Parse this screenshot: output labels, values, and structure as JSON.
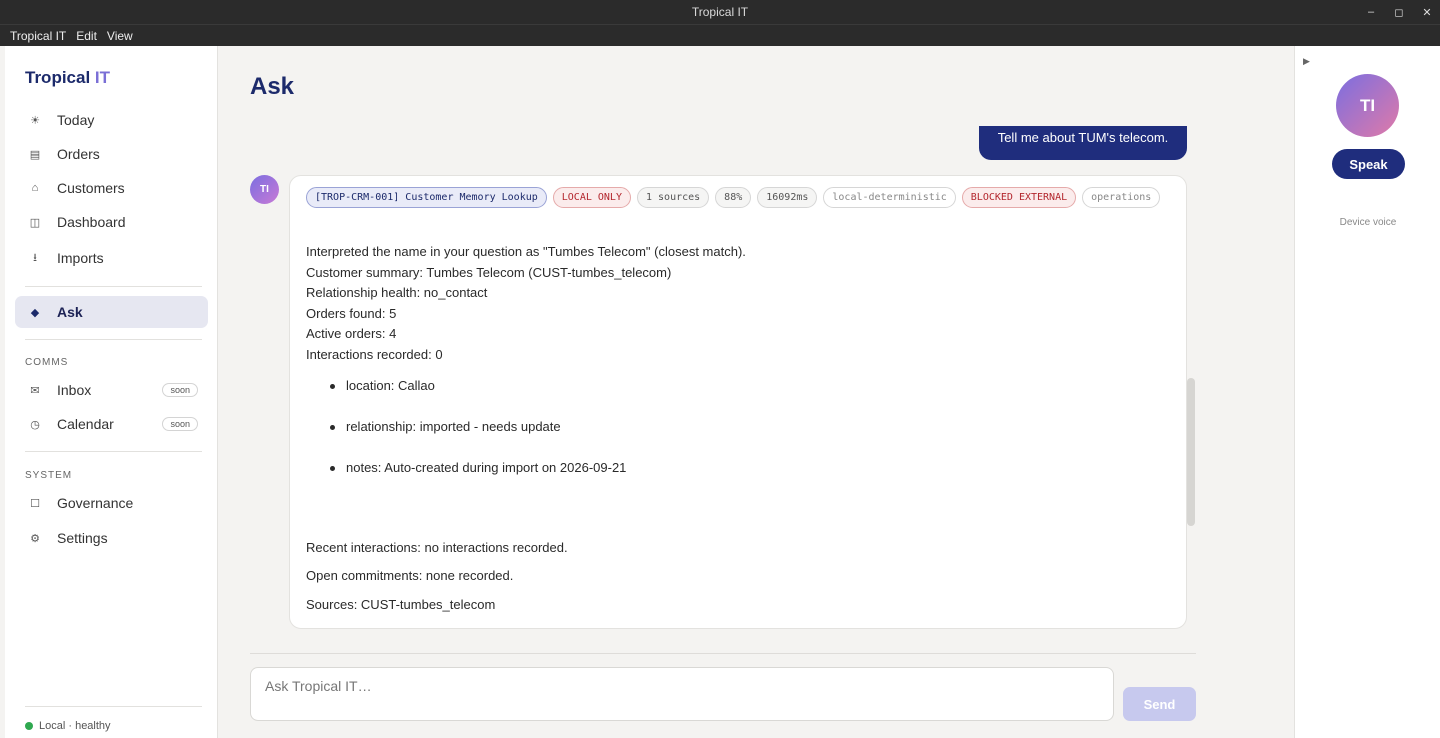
{
  "window": {
    "title": "Tropical IT",
    "controls": [
      "–",
      "◻",
      "✕"
    ]
  },
  "menu": [
    "Tropical IT",
    "Edit",
    "View"
  ],
  "brand": {
    "name": "Tropical",
    "suffix": "IT"
  },
  "nav": [
    {
      "label": "Today",
      "icon": "☀"
    },
    {
      "label": "Orders",
      "icon": "▤"
    },
    {
      "label": "Customers",
      "icon": "⌂"
    },
    {
      "label": "Dashboard",
      "icon": "◫"
    },
    {
      "label": "Imports",
      "icon": "⭳"
    },
    {
      "label": "Ask",
      "icon": "◆"
    }
  ],
  "comms": {
    "section": "COMMS",
    "items": [
      {
        "label": "Inbox",
        "icon": "✉",
        "badge": "soon"
      },
      {
        "label": "Calendar",
        "icon": "◷",
        "badge": "soon"
      }
    ]
  },
  "system": {
    "section": "SYSTEM",
    "items": [
      {
        "label": "Governance",
        "icon": "☐"
      },
      {
        "label": "Settings",
        "icon": "⚙"
      }
    ]
  },
  "status": {
    "text": "Local · healthy",
    "color": "#2fa84f"
  },
  "page": {
    "title": "Ask"
  },
  "chat": {
    "user_message": "Tell me about TUM's telecom.",
    "assistant_avatar": "TI",
    "chips": [
      "[TROP-CRM-001] Customer Memory Lookup",
      "LOCAL ONLY",
      "1 sources",
      "88%",
      "16092ms",
      "local-deterministic",
      "BLOCKED EXTERNAL",
      "operations"
    ],
    "lines": [
      "Interpreted the name in your question as \"Tumbes Telecom\" (closest match).",
      "Customer summary: Tumbes Telecom (CUST-tumbes_telecom)",
      "Relationship health: no_contact",
      "Orders found: 5",
      "Active orders: 4",
      "Interactions recorded: 0"
    ],
    "bullets": [
      "location: Callao",
      "relationship: imported - needs update",
      "notes: Auto-created during import on 2026-09-21"
    ],
    "recent": "Recent interactions: no interactions recorded.",
    "commitments": "Open commitments: none recorded.",
    "sources": "Sources: CUST-tumbes_telecom"
  },
  "composer": {
    "placeholder": "Ask Tropical IT…",
    "send_label": "Send"
  },
  "voice": {
    "avatar": "TI",
    "speak_label": "Speak",
    "device_label": "Device voice",
    "toggle": "▶"
  },
  "colors": {
    "brand": "#1c2a6b",
    "accent": "#1f2d7d",
    "danger": "#b3262d"
  }
}
